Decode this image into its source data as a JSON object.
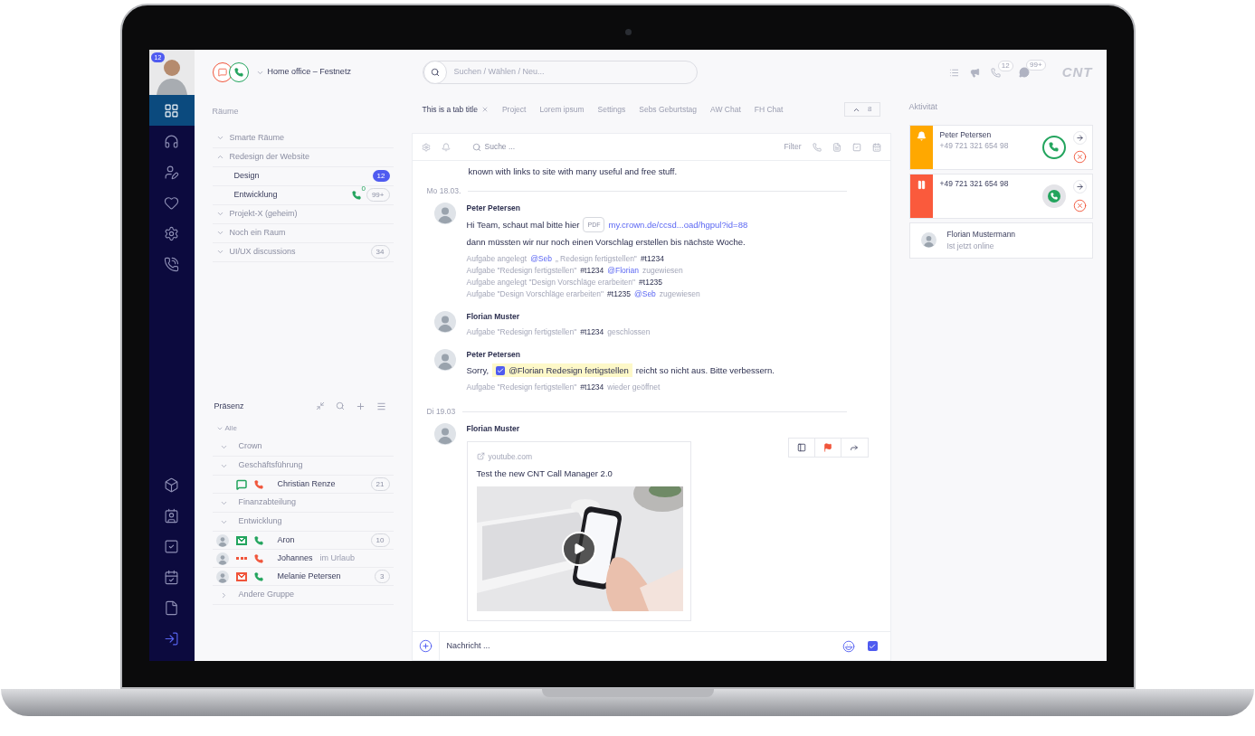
{
  "nav": {
    "profile_badge": "12",
    "items": [
      {
        "kind": "grid",
        "selected": true
      },
      {
        "kind": "headset",
        "selected": false
      },
      {
        "kind": "user-edit",
        "selected": false
      },
      {
        "kind": "heart",
        "selected": false
      },
      {
        "kind": "settings",
        "selected": false
      },
      {
        "kind": "phone-list",
        "selected": false
      }
    ],
    "bottom_items": [
      {
        "kind": "box",
        "selected": false
      },
      {
        "kind": "contacts",
        "selected": false
      },
      {
        "kind": "tasks",
        "selected": false
      },
      {
        "kind": "calendar",
        "selected": false
      },
      {
        "kind": "file",
        "selected": false
      },
      {
        "kind": "logout",
        "selected": false
      }
    ]
  },
  "status": {
    "label": "Home office – Festnetz"
  },
  "rooms": {
    "title": "Räume",
    "items": [
      {
        "label": "Smarte Räume",
        "expanded": false
      },
      {
        "label": "Redesign der Website",
        "expanded": true,
        "children": [
          {
            "label": "Design",
            "badge": "12",
            "unread": true
          },
          {
            "label": "Entwicklung",
            "badge": "99+",
            "unread": false,
            "call_count": "0"
          }
        ]
      },
      {
        "label": "Projekt-X (geheim)",
        "expanded": false
      },
      {
        "label": "Noch ein Raum",
        "expanded": false
      },
      {
        "label": "UI/UX discussions",
        "expanded": false,
        "badge": "34"
      }
    ]
  },
  "presence": {
    "title": "Präsenz",
    "all_label": "Alle",
    "groups": [
      {
        "label": "Crown",
        "expanded": false
      },
      {
        "label": "Geschäftsführung",
        "expanded": false,
        "people": [
          {
            "name": "Christian Renze",
            "avatar": false,
            "channel": {
              "kind": "chat",
              "color": "#22a45d"
            },
            "phone": {
              "color": "#f0553b"
            },
            "count": "21"
          }
        ]
      },
      {
        "label": "Finanzabteilung",
        "expanded": false
      },
      {
        "label": "Entwicklung",
        "expanded": false,
        "people": [
          {
            "name": "Aron",
            "avatar": true,
            "channel": {
              "kind": "mail",
              "color": "#22a45d"
            },
            "phone": {
              "color": "#22a45d"
            },
            "count": "10"
          },
          {
            "name": "Johannes",
            "note": "im Urlaub",
            "avatar": true,
            "channel": {
              "kind": "dots",
              "color": "#f0553b"
            },
            "phone": {
              "color": "#f0553b"
            }
          },
          {
            "name": "Melanie Petersen",
            "avatar": true,
            "channel": {
              "kind": "mail",
              "color": "#f0553b"
            },
            "phone": {
              "color": "#22a45d"
            },
            "count": "3"
          }
        ]
      },
      {
        "label": "Andere Gruppe",
        "expanded": false,
        "collapsed_right": true
      }
    ]
  },
  "search": {
    "placeholder": "Suchen / Wählen / Neu..."
  },
  "tabs": [
    {
      "label": "This is a tab title",
      "selected": true,
      "closable": true
    },
    {
      "label": "Project",
      "selected": false
    },
    {
      "label": "Lorem ipsum",
      "selected": false
    },
    {
      "label": "Settings",
      "selected": false
    },
    {
      "label": "Sebs Geburtstag",
      "selected": false
    },
    {
      "label": "AW Chat",
      "selected": false
    },
    {
      "label": "FH Chat",
      "selected": false
    }
  ],
  "tab_overflow": "8",
  "chat_toolbar": {
    "search_placeholder": "Suche ...",
    "filter": "Filter"
  },
  "messages": [
    {
      "kind": "fragment",
      "lines": [
        "known with links to site with many useful and free stuff."
      ]
    },
    {
      "kind": "date",
      "label": "Mo 18.03."
    },
    {
      "kind": "message",
      "sender": "Peter Petersen",
      "body": [
        [
          {
            "kind": "text",
            "text": "Hi Team, schaut mal bitte hier"
          },
          {
            "kind": "tag",
            "text": "PDF"
          },
          {
            "kind": "link",
            "text": "my.crown.de/ccsd...oad/hgpul?id=88"
          }
        ],
        [
          {
            "kind": "text",
            "text": "dann müssten wir nur noch einen Vorschlag erstellen bis nächste Woche."
          }
        ]
      ],
      "events": [
        [
          {
            "kind": "muted",
            "text": "Aufgabe angelegt"
          },
          {
            "kind": "mention",
            "text": "@Seb"
          },
          {
            "kind": "muted",
            "text": "„ Redesign fertigstellen\""
          },
          {
            "kind": "ref",
            "text": "#t1234"
          }
        ],
        [
          {
            "kind": "muted",
            "text": "Aufgabe \"Redesign fertigstellen\""
          },
          {
            "kind": "ref",
            "text": "#t1234"
          },
          {
            "kind": "mention",
            "text": "@Florian"
          },
          {
            "kind": "muted",
            "text": "zugewiesen"
          }
        ],
        [
          {
            "kind": "muted",
            "text": "Aufgabe angelegt \"Design Vorschläge erarbeiten\""
          },
          {
            "kind": "ref",
            "text": "#t1235"
          }
        ],
        [
          {
            "kind": "muted",
            "text": "Aufgabe \"Design Vorschläge erarbeiten\""
          },
          {
            "kind": "ref",
            "text": "#t1235"
          },
          {
            "kind": "mention",
            "text": "@Seb"
          },
          {
            "kind": "muted",
            "text": "zugewiesen"
          }
        ]
      ]
    },
    {
      "kind": "message",
      "sender": "Florian Muster",
      "events": [
        [
          {
            "kind": "muted",
            "text": "Aufgabe \"Redesign fertigstellen\""
          },
          {
            "kind": "ref",
            "text": "#t1234"
          },
          {
            "kind": "muted",
            "text": "geschlossen"
          }
        ]
      ]
    },
    {
      "kind": "message",
      "sender": "Peter Petersen",
      "body": [
        [
          {
            "kind": "text",
            "text": "Sorry,"
          },
          {
            "kind": "task",
            "text": "@Florian Redesign fertigstellen",
            "checked": true
          },
          {
            "kind": "text",
            "text": "reicht so nicht aus. Bitte verbessern."
          }
        ]
      ],
      "events": [
        [
          {
            "kind": "muted",
            "text": "Aufgabe \"Redesign fertigstellen\""
          },
          {
            "kind": "ref",
            "text": "#t1234"
          },
          {
            "kind": "muted",
            "text": "wieder geöffnet"
          }
        ]
      ]
    },
    {
      "kind": "date",
      "label": "Di 19.03"
    },
    {
      "kind": "message",
      "sender": "Florian Muster",
      "actions": true,
      "card": {
        "source": "youtube.com",
        "title": "Test the new CNT Call Manager 2.0"
      }
    }
  ],
  "composer": {
    "placeholder": "Nachricht ..."
  },
  "top_right": {
    "call_count": "12",
    "message_count": "99+",
    "logo": "CNT"
  },
  "activity": {
    "title": "Aktivität",
    "items": [
      {
        "kind": "incoming",
        "name": "Peter Petersen",
        "number": "+49 721 321 654 98"
      },
      {
        "kind": "held",
        "number": "+49 721 321 654 98"
      },
      {
        "kind": "presence",
        "name": "Florian Mustermann",
        "note": "Ist jetzt online"
      }
    ]
  }
}
